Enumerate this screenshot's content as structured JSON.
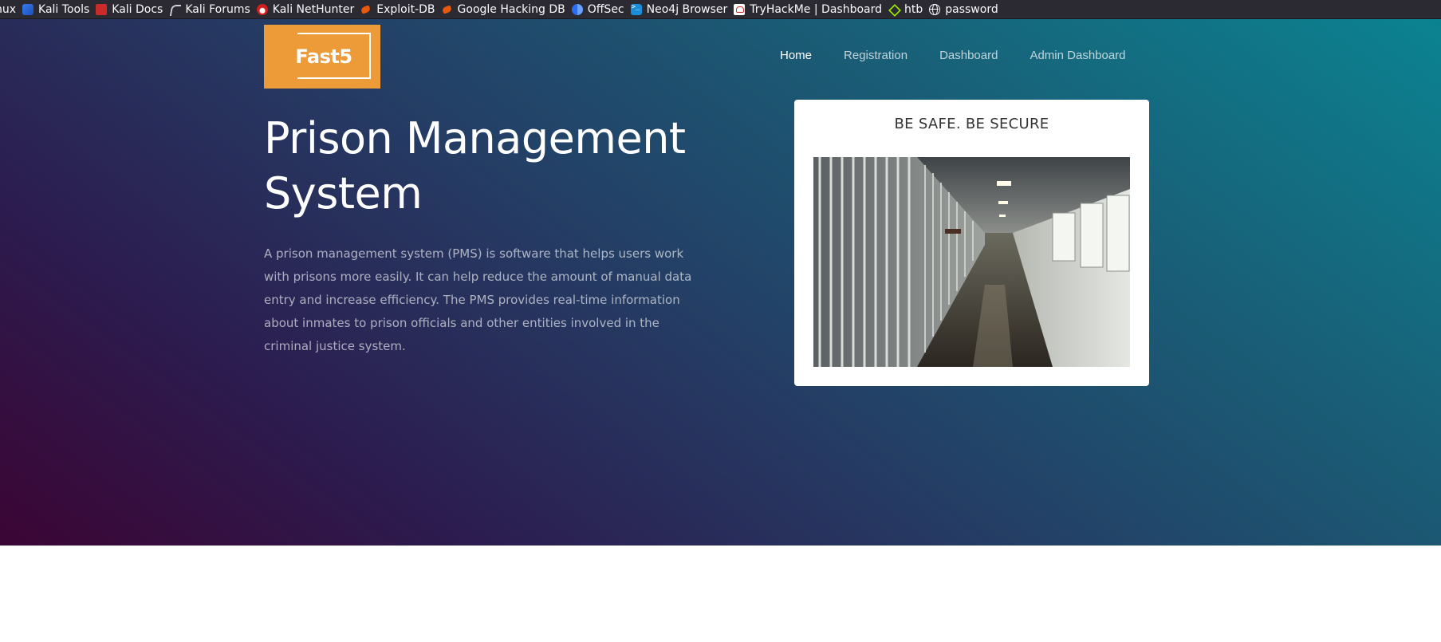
{
  "bookmarks": [
    {
      "label": "nux",
      "icon": "none"
    },
    {
      "label": "Kali Tools",
      "icon": "kali-icon"
    },
    {
      "label": "Kali Docs",
      "icon": "kali-docs-icon"
    },
    {
      "label": "Kali Forums",
      "icon": "kali-forums-icon"
    },
    {
      "label": "Kali NetHunter",
      "icon": "nethunter-icon"
    },
    {
      "label": "Exploit-DB",
      "icon": "exploit-db-icon"
    },
    {
      "label": "Google Hacking DB",
      "icon": "ghdb-icon"
    },
    {
      "label": "OffSec",
      "icon": "offsec-icon"
    },
    {
      "label": "Neo4j Browser",
      "icon": "neo4j-icon"
    },
    {
      "label": "TryHackMe | Dashboard",
      "icon": "tryhackme-icon"
    },
    {
      "label": "htb",
      "icon": "htb-icon"
    },
    {
      "label": "password",
      "icon": "globe-icon"
    }
  ],
  "header": {
    "logo_text": "Fast5",
    "nav": [
      {
        "label": "Home",
        "active": true
      },
      {
        "label": "Registration",
        "active": false
      },
      {
        "label": "Dashboard",
        "active": false
      },
      {
        "label": "Admin Dashboard",
        "active": false
      }
    ]
  },
  "hero": {
    "title": "Prison Management System",
    "description": "A prison management system (PMS) is software that helps users work with prisons more easily. It can help reduce the amount of manual data entry and increase efficiency. The PMS provides real-time information about inmates to prison officials and other entities involved in the criminal justice system."
  },
  "card": {
    "title": "BE SAFE. BE SECURE",
    "image": "prison-corridor-photo"
  },
  "colors": {
    "logo_bg": "#ed9a38",
    "gradient_start": "#3b0534",
    "gradient_end": "#0b8391",
    "bookmarks_bg": "#2b2a33"
  }
}
